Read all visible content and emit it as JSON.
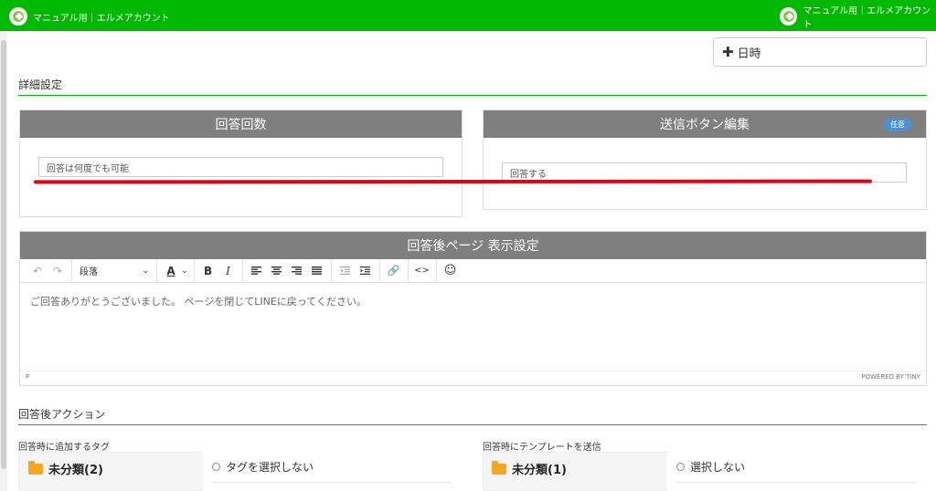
{
  "header": {
    "account_left": "マニュアル用｜エルメアカウント",
    "account_right": "マニュアル用｜エルメアカウント"
  },
  "datetime_button": {
    "icon": "plus-icon",
    "label": "日時"
  },
  "detail_settings": {
    "title": "詳細設定"
  },
  "answer_count": {
    "title": "回答回数",
    "value": "回答は何度でも可能"
  },
  "submit_button_edit": {
    "title": "送信ボタン編集",
    "badge": "任意",
    "value": "回答する"
  },
  "after_page": {
    "title": "回答後ページ 表示設定",
    "toolbar": {
      "undo": "↶",
      "redo": "↷",
      "format_select": "段落",
      "text_color": "A",
      "bold": "B",
      "italic": "I",
      "link": "🔗",
      "code": "<>",
      "emoji": "☺"
    },
    "content": "ご回答ありがとうございました。 ページを閉じてLINEに戻ってください。",
    "status_path": "P",
    "powered": "POWERED BY TINY"
  },
  "after_action": {
    "title": "回答後アクション",
    "tags": {
      "label": "回答時に追加するタグ",
      "folder": "未分類(2)",
      "option": "タグを選択しない"
    },
    "template": {
      "label": "回答時にテンプレートを送信",
      "folder": "未分類(1)",
      "option": "選択しない"
    }
  },
  "colors": {
    "brand_green": "#00b900",
    "header_gray": "#7f7f7f",
    "annotation_red": "#e60012",
    "badge_blue": "#4a90d9",
    "folder_orange": "#f5a623"
  }
}
